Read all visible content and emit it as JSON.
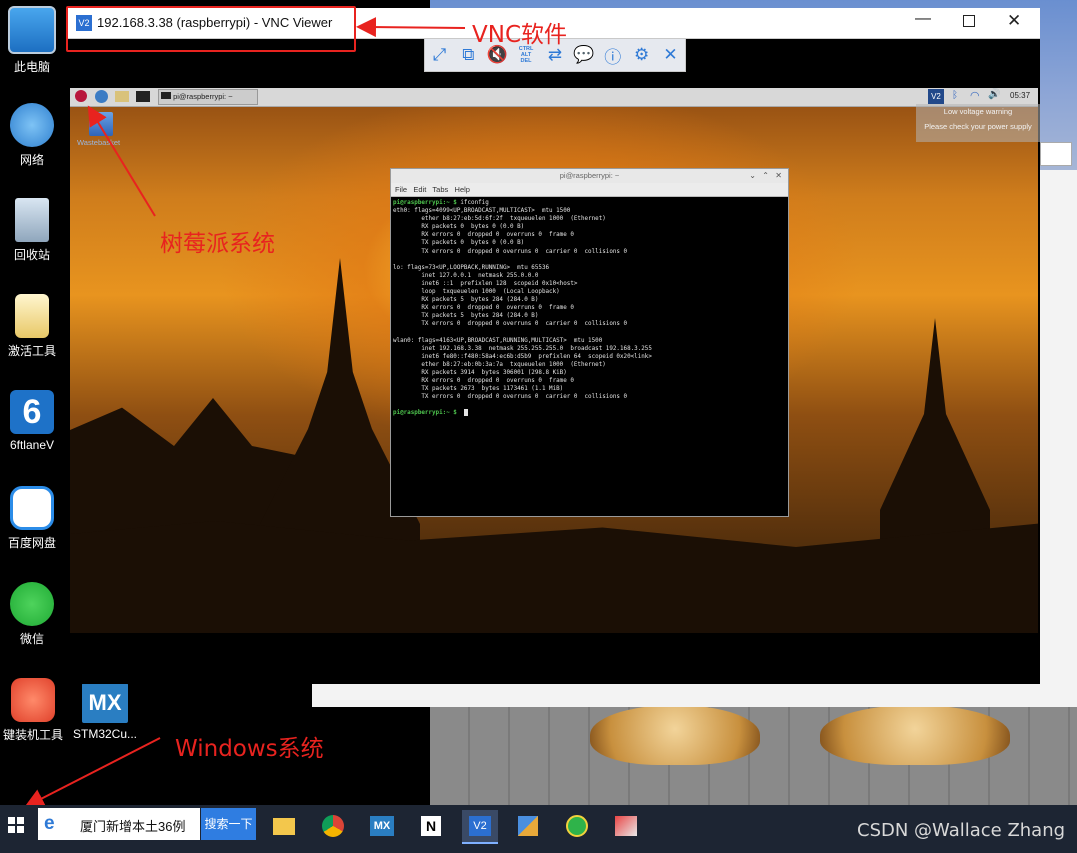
{
  "desktop": {
    "icons": [
      {
        "label": "此电脑",
        "icon": "computer-icon"
      },
      {
        "label": "网络",
        "icon": "network-icon"
      },
      {
        "label": "回收站",
        "icon": "recycle-bin-icon"
      },
      {
        "label": "激活工具",
        "icon": "folder-icon"
      },
      {
        "label": "6ftlaneV",
        "icon": "6ft-icon"
      },
      {
        "label": "百度网盘",
        "icon": "baidu-netdisk-icon"
      },
      {
        "label": "微信",
        "icon": "wechat-icon"
      },
      {
        "label": "键装机工具",
        "icon": "installer-icon"
      }
    ],
    "extra_icon": {
      "label": "STM32Cu...",
      "badge": "MX"
    }
  },
  "vnc": {
    "title": "192.168.3.38 (raspberrypi) - VNC Viewer",
    "app_badge": "V2",
    "toolbar_ctrl_alt_del": "CTRL\nALT\nDEL"
  },
  "pi": {
    "taskbar_terminal_label": "pi@raspberrypi: ~",
    "clock": "05:37",
    "tray_badge": "V2",
    "wastebasket": "Wastebasket",
    "notification": {
      "line1": "Low voltage warning",
      "line2": "Please check your power supply"
    },
    "terminal": {
      "title": "pi@raspberrypi: ~",
      "menu": [
        "File",
        "Edit",
        "Tabs",
        "Help"
      ],
      "lines": [
        {
          "p": "pi@raspberrypi:~ $ ",
          "t": "ifconfig"
        },
        {
          "t": "eth0: flags=4099<UP,BROADCAST,MULTICAST>  mtu 1500"
        },
        {
          "t": "        ether b8:27:eb:5d:6f:2f  txqueuelen 1000  (Ethernet)"
        },
        {
          "t": "        RX packets 0  bytes 0 (0.0 B)"
        },
        {
          "t": "        RX errors 0  dropped 0  overruns 0  frame 0"
        },
        {
          "t": "        TX packets 0  bytes 0 (0.0 B)"
        },
        {
          "t": "        TX errors 0  dropped 0 overruns 0  carrier 0  collisions 0"
        },
        {
          "t": ""
        },
        {
          "t": "lo: flags=73<UP,LOOPBACK,RUNNING>  mtu 65536"
        },
        {
          "t": "        inet 127.0.0.1  netmask 255.0.0.0"
        },
        {
          "t": "        inet6 ::1  prefixlen 128  scopeid 0x10<host>"
        },
        {
          "t": "        loop  txqueuelen 1000  (Local Loopback)"
        },
        {
          "t": "        RX packets 5  bytes 284 (284.0 B)"
        },
        {
          "t": "        RX errors 0  dropped 0  overruns 0  frame 0"
        },
        {
          "t": "        TX packets 5  bytes 284 (284.0 B)"
        },
        {
          "t": "        TX errors 0  dropped 0 overruns 0  carrier 0  collisions 0"
        },
        {
          "t": ""
        },
        {
          "t": "wlan0: flags=4163<UP,BROADCAST,RUNNING,MULTICAST>  mtu 1500"
        },
        {
          "t": "        inet 192.168.3.38  netmask 255.255.255.0  broadcast 192.168.3.255"
        },
        {
          "t": "        inet6 fe80::f480:58a4:ec6b:d5b9  prefixlen 64  scopeid 0x20<link>"
        },
        {
          "t": "        ether b8:27:eb:0b:3a:7a  txqueuelen 1000  (Ethernet)"
        },
        {
          "t": "        RX packets 3914  bytes 306001 (298.8 KiB)"
        },
        {
          "t": "        RX errors 0  dropped 0  overruns 0  frame 0"
        },
        {
          "t": "        TX packets 2673  bytes 1173461 (1.1 MiB)"
        },
        {
          "t": "        TX errors 0  dropped 0 overruns 0  carrier 0  collisions 0"
        },
        {
          "t": ""
        },
        {
          "p": "pi@raspberrypi:~ $ ",
          "t": "",
          "cursor": true
        }
      ]
    }
  },
  "annotations": {
    "vnc": "VNC软件",
    "pi": "树莓派系统",
    "windows": "Windows系统"
  },
  "taskbar": {
    "search_text": "厦门新增本土36例",
    "search_button": "搜索一下",
    "mx_badge": "MX",
    "vnc_badge": "V2"
  },
  "watermark": "CSDN @Wallace Zhang"
}
